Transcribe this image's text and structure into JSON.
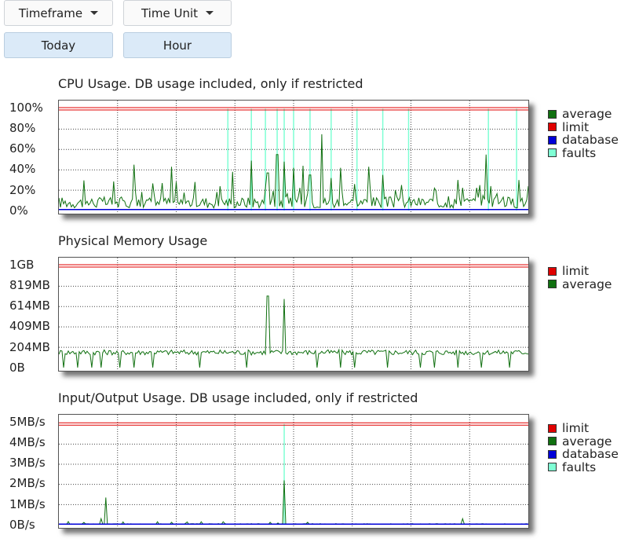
{
  "controls": {
    "timeframe_label": "Timeframe",
    "time_unit_label": "Time Unit",
    "today_label": "Today",
    "hour_label": "Hour"
  },
  "colors": {
    "average": "#107010",
    "limit": "#e00000",
    "database": "#0000d8",
    "faults": "#7fffd4"
  },
  "chart_data": [
    {
      "type": "line",
      "title": "CPU Usage. DB usage included, only if restricted",
      "y_tick_labels": [
        "100%",
        "80%",
        "60%",
        "40%",
        "20%",
        "0%"
      ],
      "ylim": [
        0,
        105
      ],
      "grid": true,
      "legend_position": "right",
      "legend": [
        "average",
        "limit",
        "database",
        "faults"
      ],
      "limit": 100,
      "average_baseline": 8,
      "average_spikes": [
        {
          "x": 0.16,
          "y": 45
        },
        {
          "x": 0.24,
          "y": 43
        },
        {
          "x": 0.29,
          "y": 28
        },
        {
          "x": 0.37,
          "y": 38
        },
        {
          "x": 0.41,
          "y": 49
        },
        {
          "x": 0.44,
          "y": 22
        },
        {
          "x": 0.445,
          "y": 37
        },
        {
          "x": 0.465,
          "y": 55
        },
        {
          "x": 0.48,
          "y": 48
        },
        {
          "x": 0.5,
          "y": 42
        },
        {
          "x": 0.52,
          "y": 44
        },
        {
          "x": 0.535,
          "y": 35
        },
        {
          "x": 0.56,
          "y": 75
        },
        {
          "x": 0.58,
          "y": 32
        },
        {
          "x": 0.6,
          "y": 42
        },
        {
          "x": 0.63,
          "y": 26
        },
        {
          "x": 0.66,
          "y": 43
        },
        {
          "x": 0.69,
          "y": 35
        },
        {
          "x": 0.73,
          "y": 25
        },
        {
          "x": 0.8,
          "y": 22
        },
        {
          "x": 0.85,
          "y": 30
        },
        {
          "x": 0.91,
          "y": 55
        },
        {
          "x": 0.98,
          "y": 30
        }
      ],
      "faults_spikes": [
        {
          "x": 0.36,
          "y": 100
        },
        {
          "x": 0.41,
          "y": 100
        },
        {
          "x": 0.44,
          "y": 100
        },
        {
          "x": 0.465,
          "y": 100
        },
        {
          "x": 0.48,
          "y": 100
        },
        {
          "x": 0.5,
          "y": 100
        },
        {
          "x": 0.535,
          "y": 100
        },
        {
          "x": 0.58,
          "y": 100
        },
        {
          "x": 0.635,
          "y": 100
        },
        {
          "x": 0.69,
          "y": 100
        },
        {
          "x": 0.745,
          "y": 100
        },
        {
          "x": 0.915,
          "y": 100
        },
        {
          "x": 0.975,
          "y": 100
        }
      ],
      "database_value": 1
    },
    {
      "type": "line",
      "title": "Physical Memory Usage",
      "y_tick_labels": [
        "1GB",
        "819MB",
        "614MB",
        "409MB",
        "204MB",
        "0B"
      ],
      "ylim": [
        0,
        1075
      ],
      "grid": true,
      "legend_position": "right",
      "legend": [
        "limit",
        "average"
      ],
      "limit": 1024,
      "average_baseline": 150,
      "average_spikes": [
        {
          "x": 0.445,
          "y": 720
        },
        {
          "x": 0.48,
          "y": 690
        }
      ],
      "average_dips": [
        0.01,
        0.04,
        0.07,
        0.09,
        0.13,
        0.16,
        0.2,
        0.3,
        0.4,
        0.55,
        0.6,
        0.63,
        0.7,
        0.77,
        0.8,
        0.85,
        0.9,
        0.96
      ]
    },
    {
      "type": "line",
      "title": "Input/Output Usage. DB usage included, only if restricted",
      "y_tick_labels": [
        "5MB/s",
        "4MB/s",
        "3MB/s",
        "2MB/s",
        "1MB/s",
        "0B/s"
      ],
      "ylim": [
        0,
        5.3
      ],
      "grid": true,
      "legend_position": "right",
      "legend": [
        "limit",
        "average",
        "database",
        "faults"
      ],
      "limit": 5,
      "average_baseline": 0.02,
      "average_spikes": [
        {
          "x": 0.1,
          "y": 1.35
        },
        {
          "x": 0.09,
          "y": 0.3
        },
        {
          "x": 0.21,
          "y": 0.15
        },
        {
          "x": 0.24,
          "y": 0.12
        },
        {
          "x": 0.35,
          "y": 0.15
        },
        {
          "x": 0.48,
          "y": 2.2
        },
        {
          "x": 0.53,
          "y": 0.12
        },
        {
          "x": 0.86,
          "y": 0.3
        }
      ],
      "faults_spikes": [
        {
          "x": 0.48,
          "y": 5
        }
      ],
      "database_value": 0.03
    }
  ]
}
